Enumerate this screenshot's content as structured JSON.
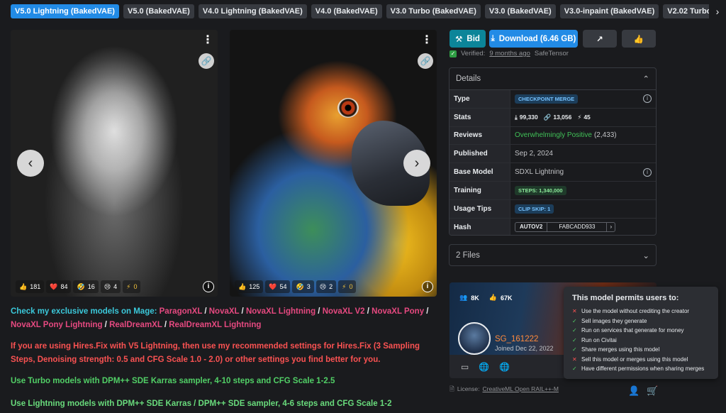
{
  "tabs": [
    "V5.0 Lightning (BakedVAE)",
    "V5.0 (BakedVAE)",
    "V4.0 Lightning (BakedVAE)",
    "V4.0 (BakedVAE)",
    "V3.0 Turbo (BakedVAE)",
    "V3.0 (BakedVAE)",
    "V3.0-inpaint (BakedVAE)",
    "V2.02 Turbo (BakedVAE)"
  ],
  "icons": {
    "tab_next": "›",
    "more": "⋮",
    "link": "🔗",
    "prev": "‹",
    "next": "›",
    "info": "i",
    "like": "👍",
    "heart": "❤️",
    "laugh": "🤣",
    "cry": "😢",
    "bolt": "⚡",
    "bid": "⚒",
    "download": "⤓",
    "share": "↗",
    "thumb": "👍",
    "verified": "✓",
    "chevron_up": "⌃",
    "chevron_down": "⌄",
    "downloads_stat": "⤓",
    "links_stat": "🔗",
    "bolt_stat": "⚡",
    "followers": "👥",
    "chip": "▭",
    "world": "🌐",
    "license": "🗎",
    "person": "👤",
    "no_cart": "🛒",
    "deny": "✕",
    "allow": "✓",
    "hash_more": "›"
  },
  "image1": {
    "reactions": {
      "like": "181",
      "heart": "84",
      "laugh": "16",
      "cry": "4",
      "bolt": "0"
    }
  },
  "image2": {
    "reactions": {
      "like": "125",
      "heart": "54",
      "laugh": "3",
      "cry": "2",
      "bolt": "0"
    }
  },
  "description": {
    "mage_intro": "Check my exclusive models on Mage: ",
    "mage_models": [
      "ParagonXL",
      "NovaXL",
      "NovaXL Lightning",
      "NovaXL V2",
      "NovaXL Pony",
      "NovaXL Pony Lightning",
      "RealDreamXL",
      "RealDreamXL Lightning"
    ],
    "separator": " / ",
    "hires": "If you are using Hires.Fix with V5 Lightning, then use my recommended settings for Hires.Fix (3 Sampling Steps, Denoising strength: 0.5 and CFG Scale 1.0 - 2.0) or other settings you find better for you.",
    "turbo": "Use Turbo models with DPM++ SDE Karras sampler, 4-10 steps and CFG Scale 1-2.5",
    "lightning": "Use Lightning models with DPM++ SDE Karras / DPM++ SDE sampler, 4-6 steps and CFG Scale 1-2"
  },
  "actions": {
    "bid": "Bid",
    "download": "Download (6.46 GB)"
  },
  "verified": {
    "label": "Verified:",
    "time": "9 months ago",
    "format": "SafeTensor"
  },
  "details": {
    "title": "Details",
    "rows": {
      "type": {
        "label": "Type",
        "value": "CHECKPOINT MERGE"
      },
      "stats": {
        "label": "Stats",
        "downloads": "99,330",
        "links": "13,056",
        "bolts": "45"
      },
      "reviews": {
        "label": "Reviews",
        "value": "Overwhelmingly Positive",
        "count": "(2,433)"
      },
      "published": {
        "label": "Published",
        "value": "Sep 2, 2024"
      },
      "base_model": {
        "label": "Base Model",
        "value": "SDXL Lightning"
      },
      "training": {
        "label": "Training",
        "value": "STEPS: 1,340,000"
      },
      "usage_tips": {
        "label": "Usage Tips",
        "value": "CLIP SKIP: 1"
      },
      "hash": {
        "label": "Hash",
        "algo": "AUTOV2",
        "value": "FABCADD933"
      }
    }
  },
  "files": {
    "label": "2 Files"
  },
  "creator": {
    "followers": "8K",
    "likes": "67K",
    "username": "SG_161222",
    "joined": "Joined Dec 22, 2022"
  },
  "license": {
    "label": "License:",
    "value": "CreativeML Open RAIL++-M"
  },
  "permissions": {
    "title": "This model permits users to:",
    "items": [
      {
        "allowed": false,
        "text": "Use the model without crediting the creator"
      },
      {
        "allowed": true,
        "text": "Sell images they generate"
      },
      {
        "allowed": true,
        "text": "Run on services that generate for money"
      },
      {
        "allowed": true,
        "text": "Run on Civitai"
      },
      {
        "allowed": true,
        "text": "Share merges using this model"
      },
      {
        "allowed": false,
        "text": "Sell this model or merges using this model"
      },
      {
        "allowed": true,
        "text": "Have different permissions when sharing merges"
      }
    ]
  },
  "colors": {
    "accent": "#228be6",
    "bid": "#0c8599",
    "mage_link": "#e64980",
    "creator_name": "#ff8a3c"
  }
}
